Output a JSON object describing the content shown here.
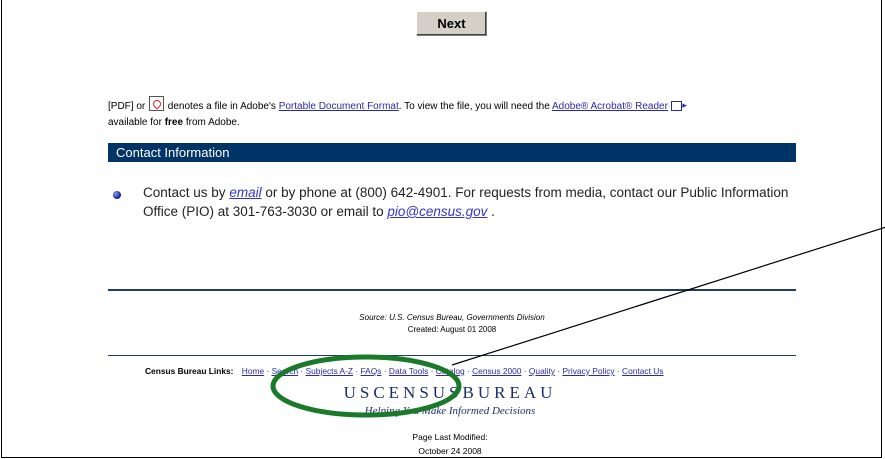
{
  "next_button": "Next",
  "pdf_notice": {
    "prefix": "[PDF] or",
    "text1": "denotes a file in Adobe's",
    "link1": "Portable Document Format",
    "text2": ". To view the file, you will need the",
    "link2": "Adobe® Acrobat® Reader",
    "text3": "available for",
    "bold": "free",
    "text4": "from Adobe."
  },
  "contact": {
    "header": "Contact Information",
    "t1": "Contact us by",
    "email_link": "email",
    "t2": "or by phone at (800) 642-4901. For requests from media, contact our Public Information Office (PIO) at 301-763-3030 or email to",
    "pio_link": "pio@census.gov",
    "t3": "."
  },
  "footer": {
    "source": "Source: U.S. Census Bureau, Governments Division",
    "created": "Created: August 01 2008",
    "links_label": "Census Bureau Links:",
    "links": [
      "Home",
      "Search",
      "Subjects A-Z",
      "FAQs",
      "Data Tools",
      "Catalog",
      "Census 2000",
      "Quality",
      "Privacy Policy",
      "Contact Us"
    ],
    "logo": "USCENSUSBUREAU",
    "tagline": "Helping You Make Informed Decisions",
    "modified_label": "Page Last Modified:",
    "modified_date": "October 24 2008"
  },
  "annotation": {
    "circle_color": "#1a7a2a",
    "line_color": "#000000"
  }
}
